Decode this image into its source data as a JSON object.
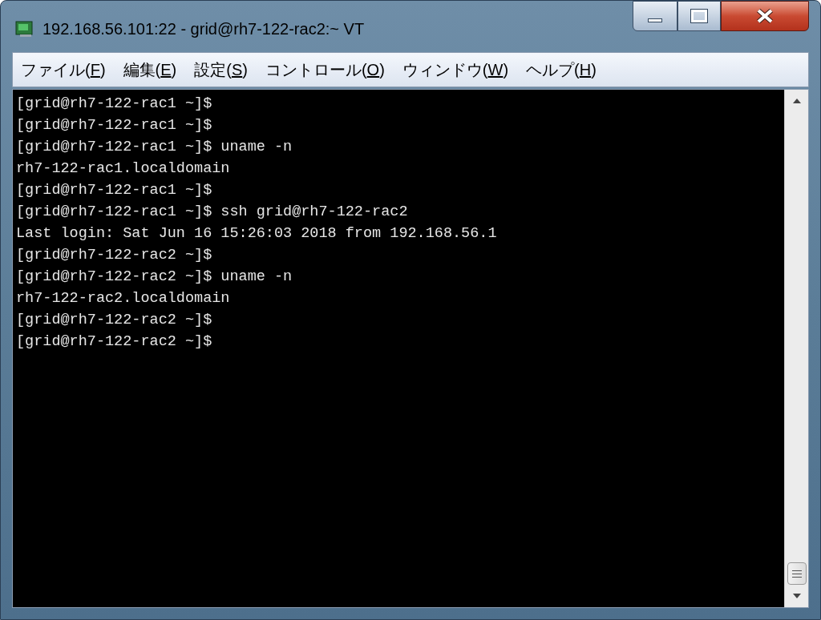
{
  "window": {
    "title": "192.168.56.101:22 - grid@rh7-122-rac2:~ VT"
  },
  "menu": [
    {
      "before": "ファイル(",
      "key": "F",
      "after": ")"
    },
    {
      "before": "編集(",
      "key": "E",
      "after": ")"
    },
    {
      "before": "設定(",
      "key": "S",
      "after": ")"
    },
    {
      "before": "コントロール(",
      "key": "O",
      "after": ")"
    },
    {
      "before": "ウィンドウ(",
      "key": "W",
      "after": ")"
    },
    {
      "before": "ヘルプ(",
      "key": "H",
      "after": ")"
    }
  ],
  "terminal": {
    "lines": [
      "[grid@rh7-122-rac1 ~]$",
      "[grid@rh7-122-rac1 ~]$",
      "[grid@rh7-122-rac1 ~]$ uname -n",
      "rh7-122-rac1.localdomain",
      "[grid@rh7-122-rac1 ~]$",
      "[grid@rh7-122-rac1 ~]$ ssh grid@rh7-122-rac2",
      "Last login: Sat Jun 16 15:26:03 2018 from 192.168.56.1",
      "[grid@rh7-122-rac2 ~]$",
      "[grid@rh7-122-rac2 ~]$ uname -n",
      "rh7-122-rac2.localdomain",
      "[grid@rh7-122-rac2 ~]$",
      "[grid@rh7-122-rac2 ~]$"
    ]
  }
}
